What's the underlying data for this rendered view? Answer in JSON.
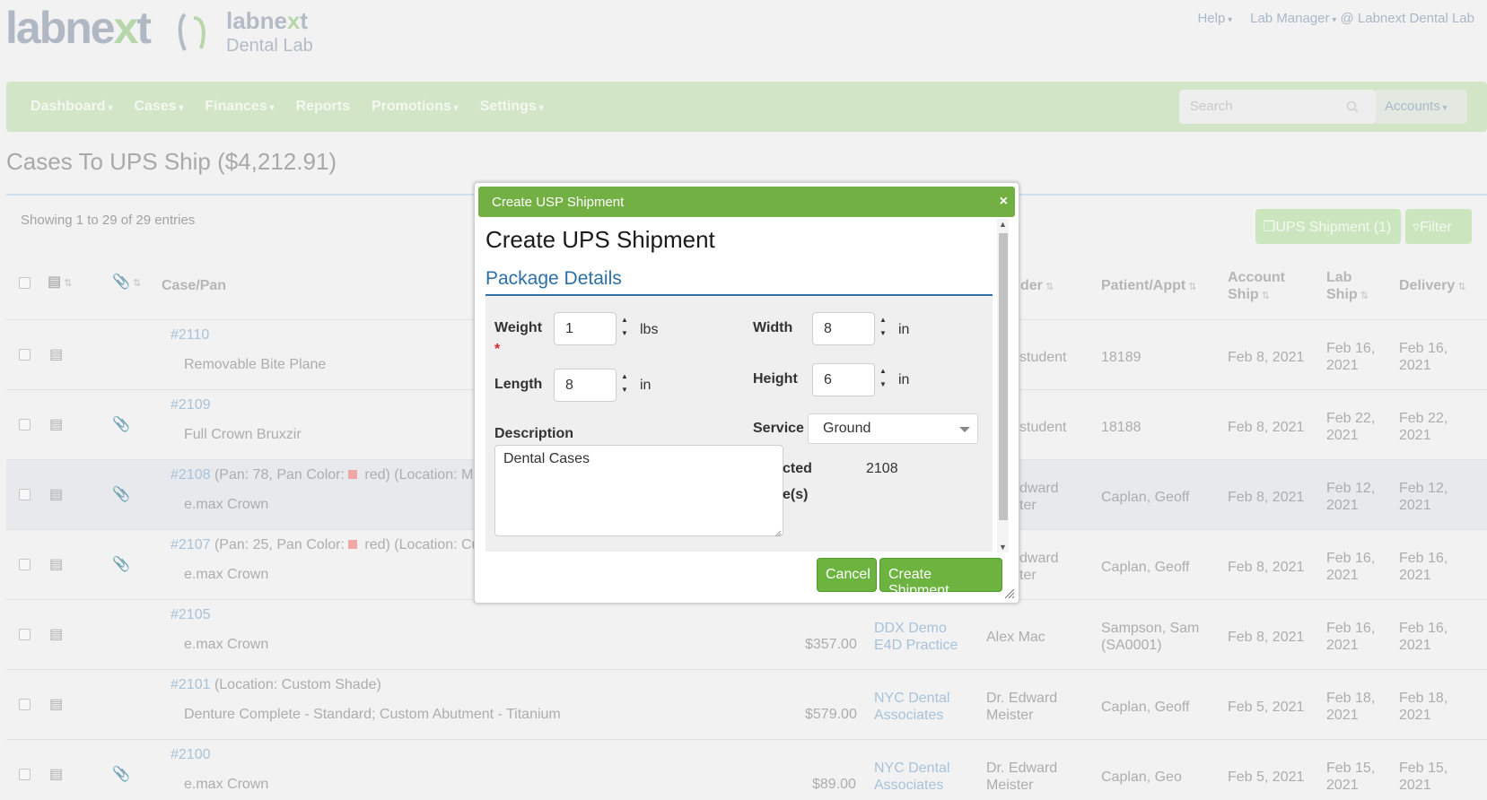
{
  "header": {
    "logo_text": "labnext",
    "lab_logo_line1": "labnext",
    "lab_logo_line2": "Dental Lab",
    "help": "Help",
    "user": "Lab Manager",
    "lab": "@ Labnext Dental Lab"
  },
  "nav": {
    "items": [
      "Dashboard",
      "Cases",
      "Finances",
      "Reports",
      "Promotions",
      "Settings"
    ],
    "dropdown": [
      true,
      true,
      true,
      false,
      true,
      true
    ],
    "search_placeholder": "Search",
    "accounts": "Accounts"
  },
  "page": {
    "title": "Cases To UPS Ship ($4,212.91)",
    "showing": "Showing 1 to 29 of 29 entries",
    "ups_button": "UPS Shipment (1)",
    "filter_button": "Filter"
  },
  "table": {
    "columns": [
      "Case/Pan",
      "der",
      "Patient/Appt",
      "Account Ship",
      "Lab Ship",
      "Delivery"
    ],
    "col_account_ship_1": "Account",
    "col_account_ship_2": "Ship",
    "col_lab_ship_1": "Lab",
    "col_lab_ship_2": "Ship",
    "rows": [
      {
        "case": "#2110",
        "extra": "",
        "item": "Removable Bite Plane",
        "price": "",
        "doctor": "",
        "provider": "student",
        "patient": "18189",
        "acct": "Feb 8, 2021",
        "lab1": "Feb 16,",
        "lab2": "2021",
        "del1": "Feb 16,",
        "del2": "2021",
        "checked": false,
        "attach": false
      },
      {
        "case": "#2109",
        "extra": "",
        "item": "Full Crown Bruxzir",
        "price": "",
        "doctor": "",
        "provider": "student",
        "patient": "18188",
        "acct": "Feb 8, 2021",
        "lab1": "Feb 22,",
        "lab2": "2021",
        "del1": "Feb 22,",
        "del2": "2021",
        "checked": false,
        "attach": true
      },
      {
        "case": "#2108",
        "extra_a": " (Pan: 78, Pan Color:",
        "extra_b": " red) (Location: Mil",
        "item": "e.max Crown",
        "price": "",
        "doctor": "",
        "provider1": "dward",
        "provider2": "ter",
        "patient": "Caplan, Geoff",
        "acct": "Feb 8, 2021",
        "lab1": "Feb 12,",
        "lab2": "2021",
        "del1": "Feb 12,",
        "del2": "2021",
        "checked": true,
        "attach": true
      },
      {
        "case": "#2107",
        "extra_a": " (Pan: 25, Pan Color:",
        "extra_b": " red) (Location: Cu",
        "item": "e.max Crown",
        "price": "",
        "doctor": "",
        "provider1": "dward",
        "provider2": "ter",
        "patient": "Caplan, Geoff",
        "acct": "Feb 8, 2021",
        "lab1": "Feb 16,",
        "lab2": "2021",
        "del1": "Feb 16,",
        "del2": "2021",
        "checked": false,
        "attach": true
      },
      {
        "case": "#2105",
        "extra": "",
        "item": "e.max Crown",
        "price": "$357.00",
        "doctor1": "DDX Demo",
        "doctor2": "E4D Practice",
        "provider": "Alex Mac",
        "patient1": "Sampson, Sam",
        "patient2": "(SA0001)",
        "acct": "Feb 8, 2021",
        "lab1": "Feb 16,",
        "lab2": "2021",
        "del1": "Feb 16,",
        "del2": "2021",
        "checked": false,
        "attach": false
      },
      {
        "case": "#2101",
        "extra": " (Location: Custom Shade)",
        "item": "Denture Complete - Standard; Custom Abutment - Titanium",
        "price": "$579.00",
        "doctor1": "NYC Dental",
        "doctor2": "Associates",
        "provider1": "Dr. Edward",
        "provider2": "Meister",
        "patient": "Caplan, Geoff",
        "acct": "Feb 5, 2021",
        "lab1": "Feb 18,",
        "lab2": "2021",
        "del1": "Feb 18,",
        "del2": "2021",
        "checked": false,
        "attach": false
      },
      {
        "case": "#2100",
        "extra": "",
        "item": "e.max Crown",
        "price": "$89.00",
        "doctor1": "NYC Dental",
        "doctor2": "Associates",
        "provider1": "Dr. Edward",
        "provider2": "Meister",
        "patient": "Caplan, Geo",
        "acct": "Feb 5, 2021",
        "lab1": "Feb 15,",
        "lab2": "2021",
        "del1": "Feb 15,",
        "del2": "2021",
        "checked": false,
        "attach": true
      }
    ]
  },
  "dialog": {
    "title_bar": "Create USP Shipment",
    "close": "×",
    "heading": "Create UPS Shipment",
    "section": "Package Details",
    "weight_label": "Weight",
    "required_mark": "*",
    "weight_value": "1",
    "weight_unit": "lbs",
    "length_label": "Length",
    "length_value": "8",
    "length_unit": "in",
    "width_label": "Width",
    "width_value": "8",
    "width_unit": "in",
    "height_label": "Height",
    "height_value": "6",
    "height_unit": "in",
    "description_label": "Description",
    "description_value": "Dental Cases",
    "service_label": "Service",
    "service_value": "Ground",
    "selected_label_1": "cted",
    "selected_label_2": "e(s)",
    "selected_value": "2108",
    "cancel": "Cancel",
    "create": "Create Shipment"
  },
  "colors": {
    "accent_green": "#6cb33f",
    "title_bar_green": "#72b043",
    "section_blue": "#2c6fa6",
    "required_red": "#d9232e"
  }
}
